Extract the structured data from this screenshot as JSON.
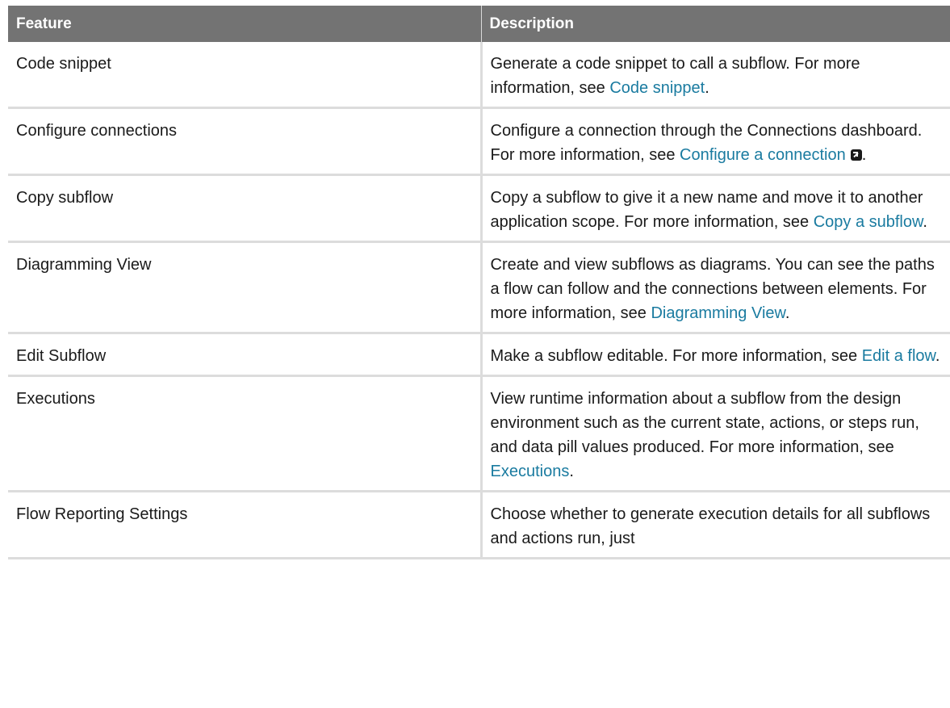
{
  "table": {
    "headers": [
      "Feature",
      "Description"
    ],
    "rows": [
      {
        "feature": "Code snippet",
        "desc_before": "Generate a code snippet to call a subflow. For more information, see ",
        "link": "Code snippet",
        "desc_after": "."
      },
      {
        "feature": "Configure connections",
        "desc_before": "Configure a connection through the Connections dashboard. For more information, see ",
        "link": "Configure a connection",
        "external_icon": "external-link-icon",
        "desc_after": "."
      },
      {
        "feature": "Copy subflow",
        "desc_before": "Copy a subflow to give it a new name and move it to another application scope. For more information, see ",
        "link": "Copy a subflow",
        "desc_after": "."
      },
      {
        "feature": "Diagramming View",
        "desc_before": "Create and view subflows as diagrams. You can see the paths a flow can follow and the connections between elements. For more information, see ",
        "link": "Diagramming View",
        "desc_after": "."
      },
      {
        "feature": "Edit Subflow",
        "desc_before": "Make a subflow editable. For more information, see ",
        "link": "Edit a flow",
        "desc_after": "."
      },
      {
        "feature": "Executions",
        "desc_before": "View runtime information about a subflow from the design environment such as the current state, actions, or steps run, and data pill values produced. For more information, see ",
        "link": "Executions",
        "desc_after": "."
      },
      {
        "feature": "Flow Reporting Settings",
        "desc_before": "Choose whether to generate execution details for all subflows and actions run, just",
        "link": "",
        "desc_after": ""
      }
    ]
  },
  "colors": {
    "header_bg": "#737373",
    "link": "#1a7ba0",
    "border": "#dcdcdc"
  }
}
